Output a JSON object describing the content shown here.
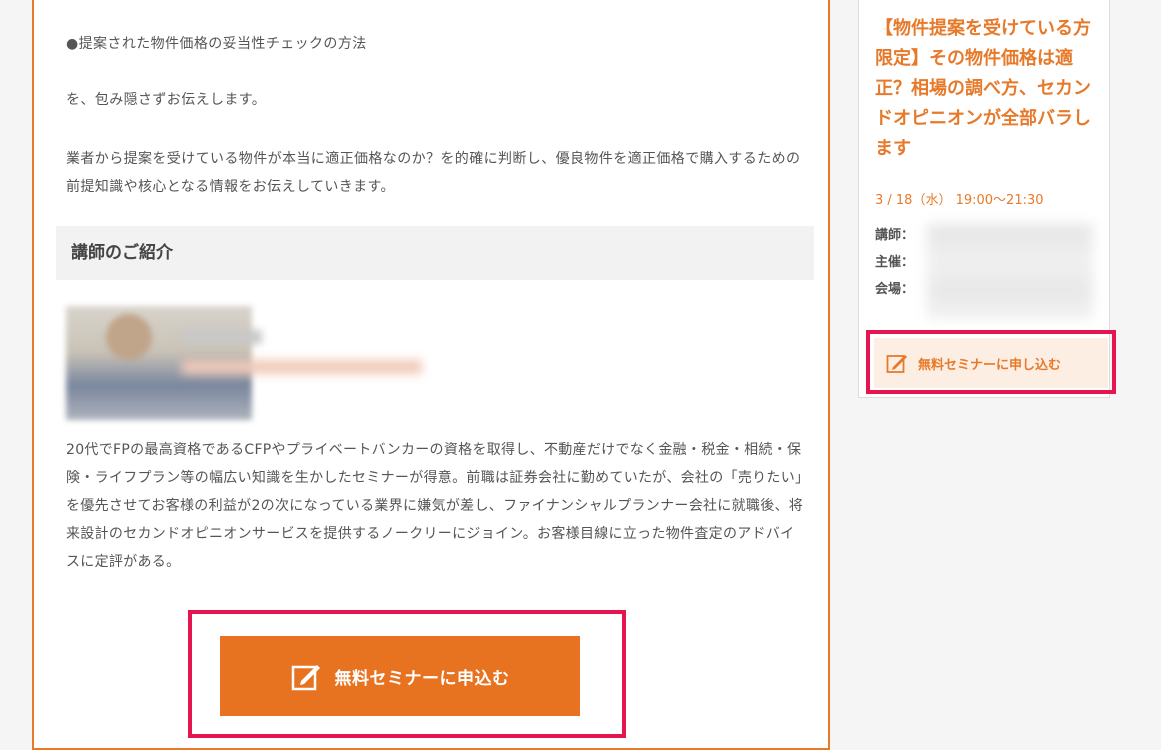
{
  "main": {
    "paragraph_1": "●提案された物件価格の妥当性チェックの方法",
    "paragraph_2": "を、包み隠さずお伝えします。",
    "paragraph_3": "業者から提案を受けている物件が本当に適正価格なのか？を的確に判断し、優良物件を適正価格で購入するための前提知識や核心となる情報をお伝えしていきます。",
    "section_heading": "講師のご紹介",
    "bio": "20代でFPの最高資格であるCFPやプライベートバンカーの資格を取得し、不動産だけでなく金融・税金・相続・保険・ライフプラン等の幅広い知識を生かしたセミナーが得意。前職は証券会社に勤めていたが、会社の「売りたい」を優先させてお客様の利益が2の次になっている業界に嫌気が差し、ファイナンシャルプランナー会社に就職後、将来設計のセカンドオピニオンサービスを提供するノークリーにジョイン。お客様目線に立った物件査定のアドバイスに定評がある。",
    "cta_label": "無料セミナーに申込む"
  },
  "sidebar": {
    "title": "【物件提案を受けている方限定】その物件価格は適正？相場の調べ方、セカンドオピニオンが全部バラします",
    "date": "3 / 18（水） 19:00〜21:30",
    "label_instructor": "講師：",
    "label_organizer": "主催：",
    "label_venue": "会場：",
    "cta_label": "無料セミナーに申し込む"
  },
  "colors": {
    "accent": "#e77220",
    "highlight": "#e6154f",
    "frame": "#e77a2a"
  },
  "icons": {
    "cta_icon": "edit-icon"
  }
}
